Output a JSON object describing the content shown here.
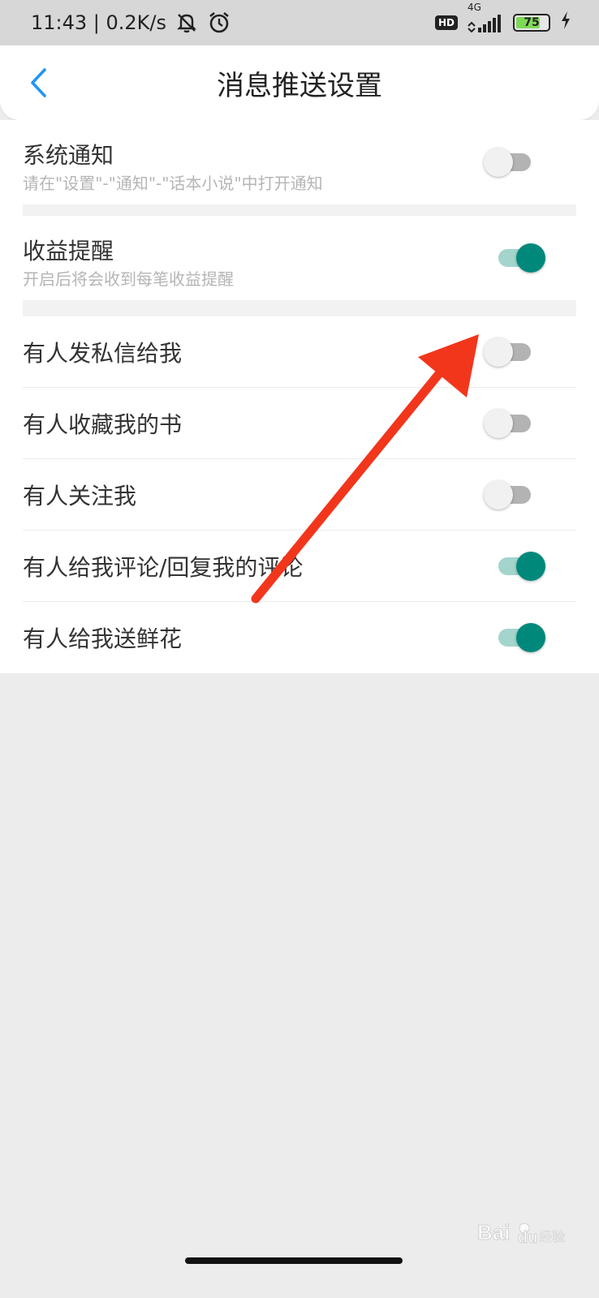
{
  "status_bar": {
    "time_speed": "11:43 | 0.2K/s",
    "network": "4G",
    "hd": "HD",
    "battery": "75",
    "battery_level": 0.75
  },
  "header": {
    "title": "消息推送设置"
  },
  "settings": {
    "system_notice": {
      "title": "系统通知",
      "desc": "请在\"设置\"-\"通知\"-\"话本小说\"中打开通知",
      "on": false
    },
    "earnings_reminder": {
      "title": "收益提醒",
      "desc": "开启后将会收到每笔收益提醒",
      "on": true
    },
    "items": [
      {
        "title": "有人发私信给我",
        "on": false
      },
      {
        "title": "有人收藏我的书",
        "on": false
      },
      {
        "title": "有人关注我",
        "on": false
      },
      {
        "title": "有人给我评论/回复我的评论",
        "on": true
      },
      {
        "title": "有人给我送鲜花",
        "on": true
      }
    ]
  },
  "colors": {
    "accent": "#00897b",
    "accent_track": "#a3d5cd",
    "back_icon": "#2196f3",
    "annotation": "#f2361c"
  },
  "watermark": "Baidu经验"
}
